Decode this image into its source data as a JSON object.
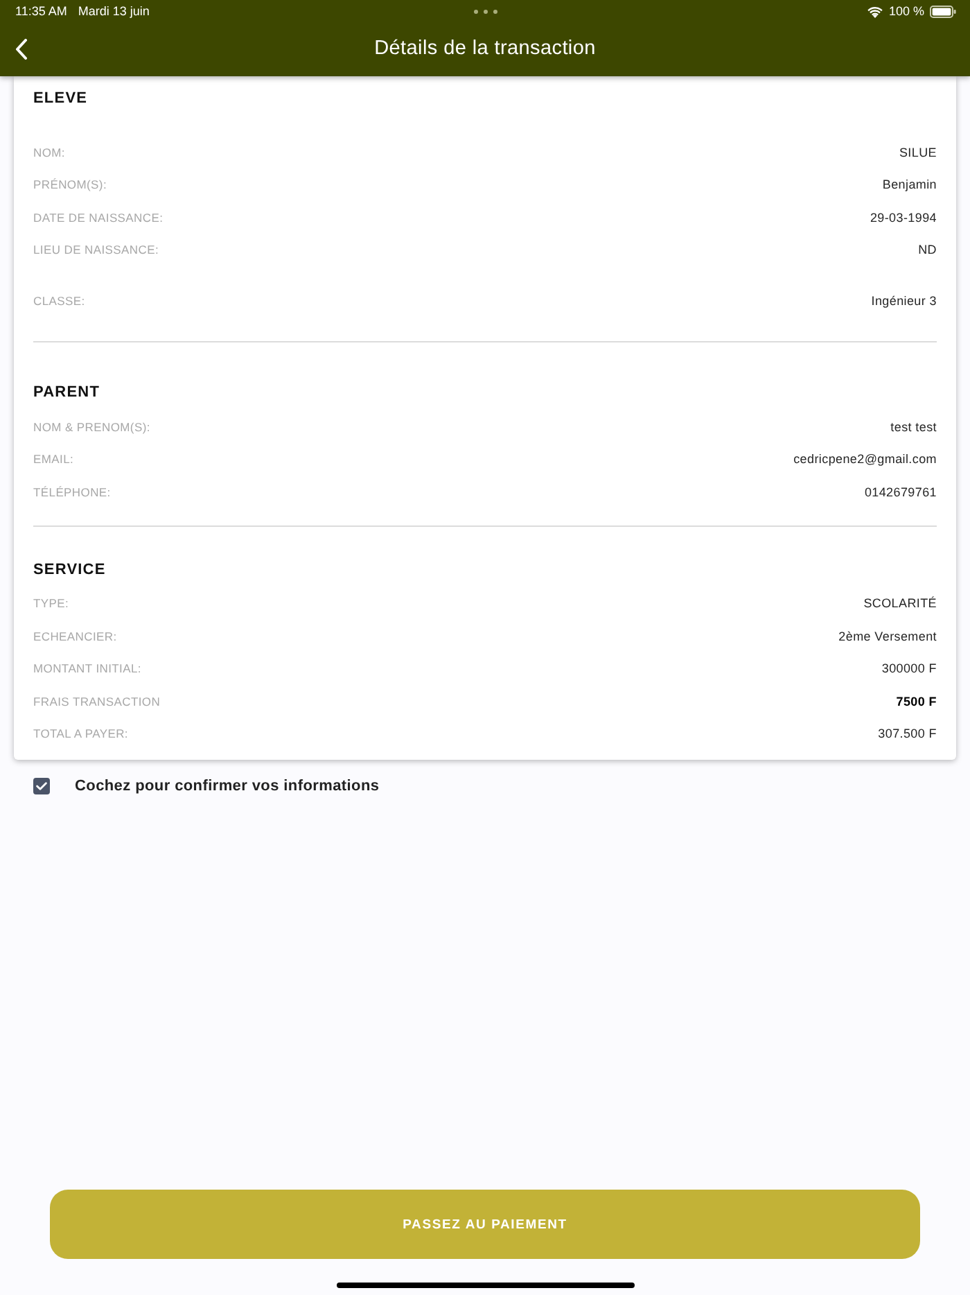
{
  "status_bar": {
    "time": "11:35 AM",
    "date": "Mardi 13 juin",
    "battery": "100 %"
  },
  "nav_bar": {
    "title": "Détails de la transaction"
  },
  "sections": [
    {
      "title": "ELEVE",
      "groups": [
        {
          "rows": [
            {
              "label": "NOM:",
              "value": "SILUE",
              "emphasized": false
            },
            {
              "label": "PRÉNOM(S):",
              "value": "Benjamin",
              "emphasized": false
            },
            {
              "label": "DATE DE NAISSANCE:",
              "value": "29-03-1994",
              "emphasized": false
            },
            {
              "label": "LIEU DE NAISSANCE:",
              "value": "ND",
              "emphasized": false
            }
          ]
        },
        {
          "rows": [
            {
              "label": "CLASSE:",
              "value": "Ingénieur 3",
              "emphasized": false
            }
          ]
        }
      ]
    },
    {
      "title": "PARENT",
      "groups": [
        {
          "rows": [
            {
              "label": "NOM & PRENOM(S):",
              "value": "test test",
              "emphasized": false
            },
            {
              "label": "EMAIL:",
              "value": "cedricpene2@gmail.com",
              "emphasized": false
            },
            {
              "label": "TÉLÉPHONE:",
              "value": "0142679761",
              "emphasized": false
            }
          ]
        }
      ]
    },
    {
      "title": "SERVICE",
      "groups": [
        {
          "rows": [
            {
              "label": "TYPE:",
              "value": "SCOLARITÉ",
              "emphasized": false
            },
            {
              "label": "ECHEANCIER:",
              "value": "2ème Versement",
              "emphasized": false
            },
            {
              "label": "MONTANT INITIAL:",
              "value": "300000 F",
              "emphasized": false
            },
            {
              "label": "FRAIS TRANSACTION",
              "value": "7500 F",
              "emphasized": true
            },
            {
              "label": "TOTAL A PAYER:",
              "value": "307.500 F",
              "emphasized": false
            }
          ]
        }
      ]
    }
  ],
  "confirm": {
    "label": "Cochez pour confirmer vos informations",
    "checked": true
  },
  "pay_button": {
    "label": "PASSEZ AU PAIEMENT"
  }
}
